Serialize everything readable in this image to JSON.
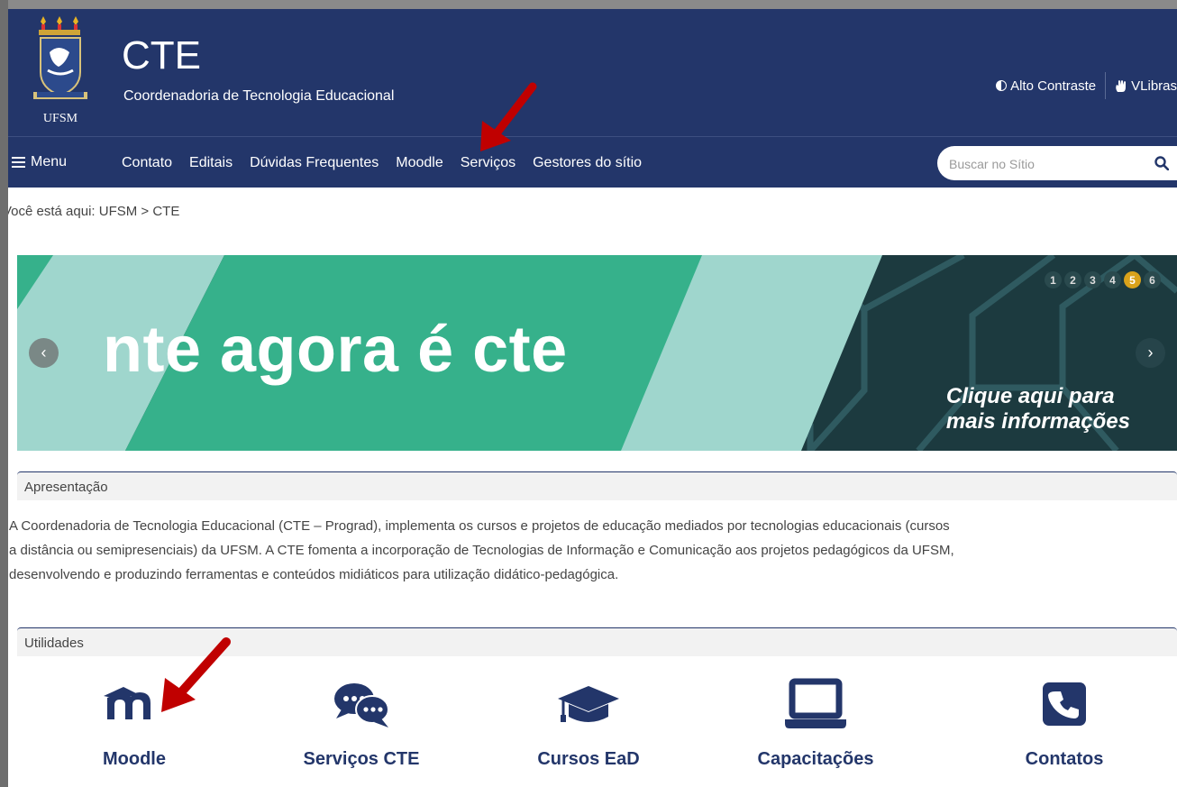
{
  "header": {
    "logo_text": "UFSM",
    "title": "CTE",
    "subtitle": "Coordenadoria de Tecnologia Educacional",
    "contrast_label": "Alto Contraste",
    "vlibras_label": "VLibras"
  },
  "nav": {
    "menu_label": "Menu",
    "links": [
      "Contato",
      "Editais",
      "Dúvidas Frequentes",
      "Moodle",
      "Serviços",
      "Gestores do sítio"
    ],
    "search_placeholder": "Buscar no Sítio"
  },
  "breadcrumb": "Você está aqui: UFSM > CTE",
  "banner": {
    "headline": "nte agora é cte",
    "cta_line1": "Clique aqui para",
    "cta_line2": "mais informações",
    "slides": [
      "1",
      "2",
      "3",
      "4",
      "5",
      "6"
    ],
    "active_slide": "5",
    "prev_label": "‹",
    "next_label": "›"
  },
  "apresentacao": {
    "heading": "Apresentação",
    "text_line1": "A Coordenadoria de Tecnologia Educacional (CTE – Prograd), implementa os cursos e projetos de educação mediados por tecnologias educacionais (cursos",
    "text_line2": "a distância ou semipresenciais) da UFSM. A CTE fomenta a incorporação de Tecnologias de Informação e Comunicação aos projetos pedagógicos da UFSM,",
    "text_line3": "desenvolvendo e produzindo ferramentas e conteúdos midiáticos para utilização didático-pedagógica."
  },
  "utilidades": {
    "heading": "Utilidades",
    "items": [
      {
        "label": "Moodle",
        "icon": "moodle-icon"
      },
      {
        "label": "Serviços CTE",
        "icon": "chat-bubbles-icon"
      },
      {
        "label": "Cursos EaD",
        "icon": "graduation-cap-icon"
      },
      {
        "label": "Capacitações",
        "icon": "laptop-icon"
      },
      {
        "label": "Contatos",
        "icon": "phone-icon"
      }
    ]
  },
  "colors": {
    "brand_navy": "#23366a",
    "banner_green": "#36b18b",
    "banner_mint": "#9fd6cd",
    "banner_dark": "#1c3a3f",
    "active_dot": "#d9a21b",
    "annotation_red": "#c00000"
  }
}
